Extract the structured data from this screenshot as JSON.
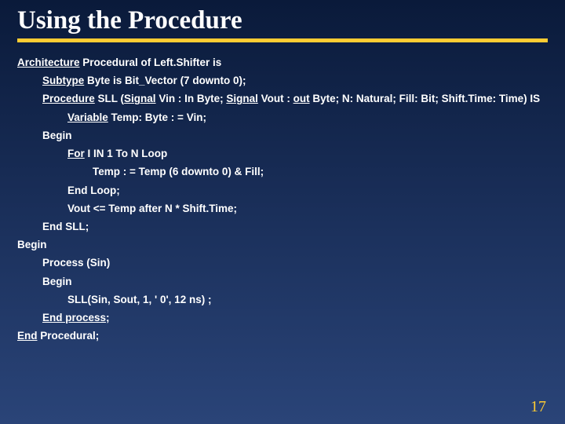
{
  "title": "Using the Procedure",
  "pagenum": "17",
  "code": {
    "l1a": "Architecture",
    "l1b": " Procedural of Left.Shifter is",
    "l2a": "Subtype",
    "l2b": " Byte is Bit_Vector (7 downto 0);",
    "l3a": "Procedure",
    "l3b": " SLL (",
    "l3c": "Signal",
    "l3d": " Vin : In Byte; ",
    "l3e": "Signal",
    "l3f": " Vout : ",
    "l3g": "out",
    "l3h": " Byte; N: Natural; Fill: Bit; Shift.Time: Time) IS",
    "l4a": "Variable",
    "l4b": " Temp: Byte : = Vin;",
    "l5": "Begin",
    "l6a": "For",
    "l6b": " I IN 1 To N Loop",
    "l7": "Temp : = Temp (6 downto 0) & Fill;",
    "l8": "End Loop;",
    "l9": "Vout <= Temp after N * Shift.Time;",
    "l10": "End SLL;",
    "l11": "Begin",
    "l12": "Process (Sin)",
    "l13": "Begin",
    "l14": "SLL(Sin, Sout, 1, ' 0', 12 ns) ;",
    "l15a": "End process",
    "l15b": ";",
    "l16a": "End",
    "l16b": " Procedural;"
  }
}
